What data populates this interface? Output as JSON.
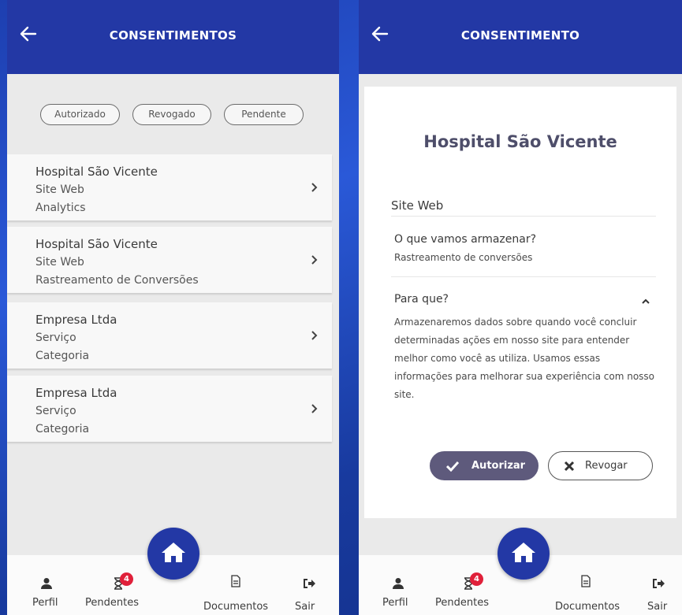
{
  "left": {
    "title": "CONSENTIMENTOS",
    "filters": [
      "Autorizado",
      "Revogado",
      "Pendente"
    ],
    "cards": [
      {
        "title": "Hospital São Vicente",
        "line2": "Site Web",
        "line3": "Analytics"
      },
      {
        "title": "Hospital São Vicente",
        "line2": "Site Web",
        "line3": "Rastreamento de Conversões"
      },
      {
        "title": "Empresa Ltda",
        "line2": "Serviço",
        "line3": "Categoria"
      },
      {
        "title": "Empresa Ltda",
        "line2": "Serviço",
        "line3": "Categoria"
      }
    ]
  },
  "right": {
    "title": "CONSENTIMENTO",
    "hospital": "Hospital São Vicente",
    "section": "Site Web",
    "question1": "O que vamos armazenar?",
    "answer1": "Rastreamento de conversões",
    "question2": "Para que?",
    "answer2": "Armazenaremos dados sobre quando você concluir determinadas ações em nosso site para entender melhor como você as utiliza. Usamos essas informações para melhorar sua experiência com nosso site.",
    "authorize_label": "Autorizar",
    "revoke_label": "Revogar"
  },
  "nav": {
    "profile": "Perfil",
    "pending": "Pendentes",
    "pending_count": "4",
    "documents": "Documentos",
    "exit": "Sair"
  },
  "colors": {
    "appbar": "#2338a5",
    "authorize_button": "#5e5a7c",
    "badge": "#e0203a"
  },
  "icons": [
    "back-arrow-icon",
    "chevron-right-icon",
    "chevron-up-icon",
    "home-icon",
    "person-icon",
    "hourglass-icon",
    "document-icon",
    "exit-icon",
    "check-icon",
    "x-icon"
  ]
}
